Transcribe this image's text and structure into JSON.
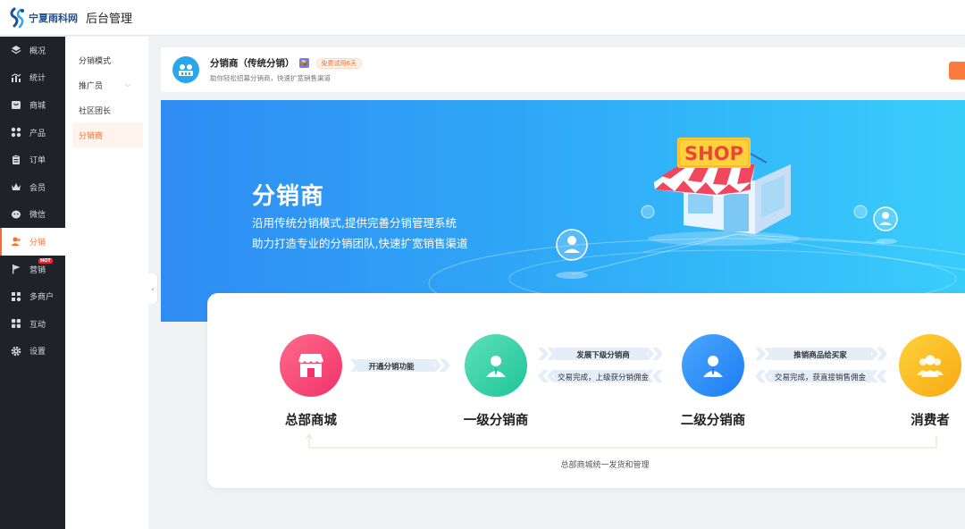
{
  "header": {
    "logo_text": "宁夏雨科网",
    "app_title": "后台管理"
  },
  "sidebar": {
    "items": [
      {
        "label": "概况",
        "icon": "layers-icon"
      },
      {
        "label": "统计",
        "icon": "stats-icon"
      },
      {
        "label": "商城",
        "icon": "store-icon"
      },
      {
        "label": "产品",
        "icon": "grid-icon"
      },
      {
        "label": "订单",
        "icon": "clipboard-icon"
      },
      {
        "label": "会员",
        "icon": "crown-icon"
      },
      {
        "label": "微信",
        "icon": "wechat-icon"
      },
      {
        "label": "分销",
        "icon": "users-icon"
      },
      {
        "label": "营销",
        "icon": "flag-icon"
      },
      {
        "label": "多商户",
        "icon": "merchant-icon"
      },
      {
        "label": "互动",
        "icon": "interact-icon"
      },
      {
        "label": "设置",
        "icon": "gear-icon"
      }
    ],
    "active_index": 7,
    "hot_badge": "HOT"
  },
  "submenu": {
    "items": [
      {
        "label": "分销模式"
      },
      {
        "label": "推广员",
        "has_children": true
      },
      {
        "label": "社区团长"
      },
      {
        "label": "分销商"
      }
    ],
    "active_index": 3
  },
  "info": {
    "title": "分销商（传统分销）",
    "vip_badge": "📦",
    "trial_badge": "免费试用6天",
    "subtitle": "助你轻松招募分销商，快速扩宽销售渠道"
  },
  "banner": {
    "title": "分销商",
    "line1": "沿用传统分销模式,提供完善分销管理系统",
    "line2": "助力打造专业的分销团队,快速扩宽销售渠道",
    "shop_sign": "SHOP"
  },
  "flow": {
    "nodes": [
      {
        "label": "总部商城"
      },
      {
        "label": "一级分销商"
      },
      {
        "label": "二级分销商"
      },
      {
        "label": "消费者"
      }
    ],
    "arrows": {
      "a1_top": "开通分销功能",
      "a2_top": "发展下级分销商",
      "a2_bottom": "交易完成，上级获分销佣金",
      "a3_top": "推销商品给买家",
      "a3_bottom": "交易完成，获直接销售佣金"
    },
    "footer": "总部商城统一发货和管理"
  },
  "colors": {
    "accent": "#fa6b2c",
    "sidebar_bg": "#1f2329",
    "banner_start": "#2f8cf3",
    "banner_end": "#39cdfb"
  }
}
